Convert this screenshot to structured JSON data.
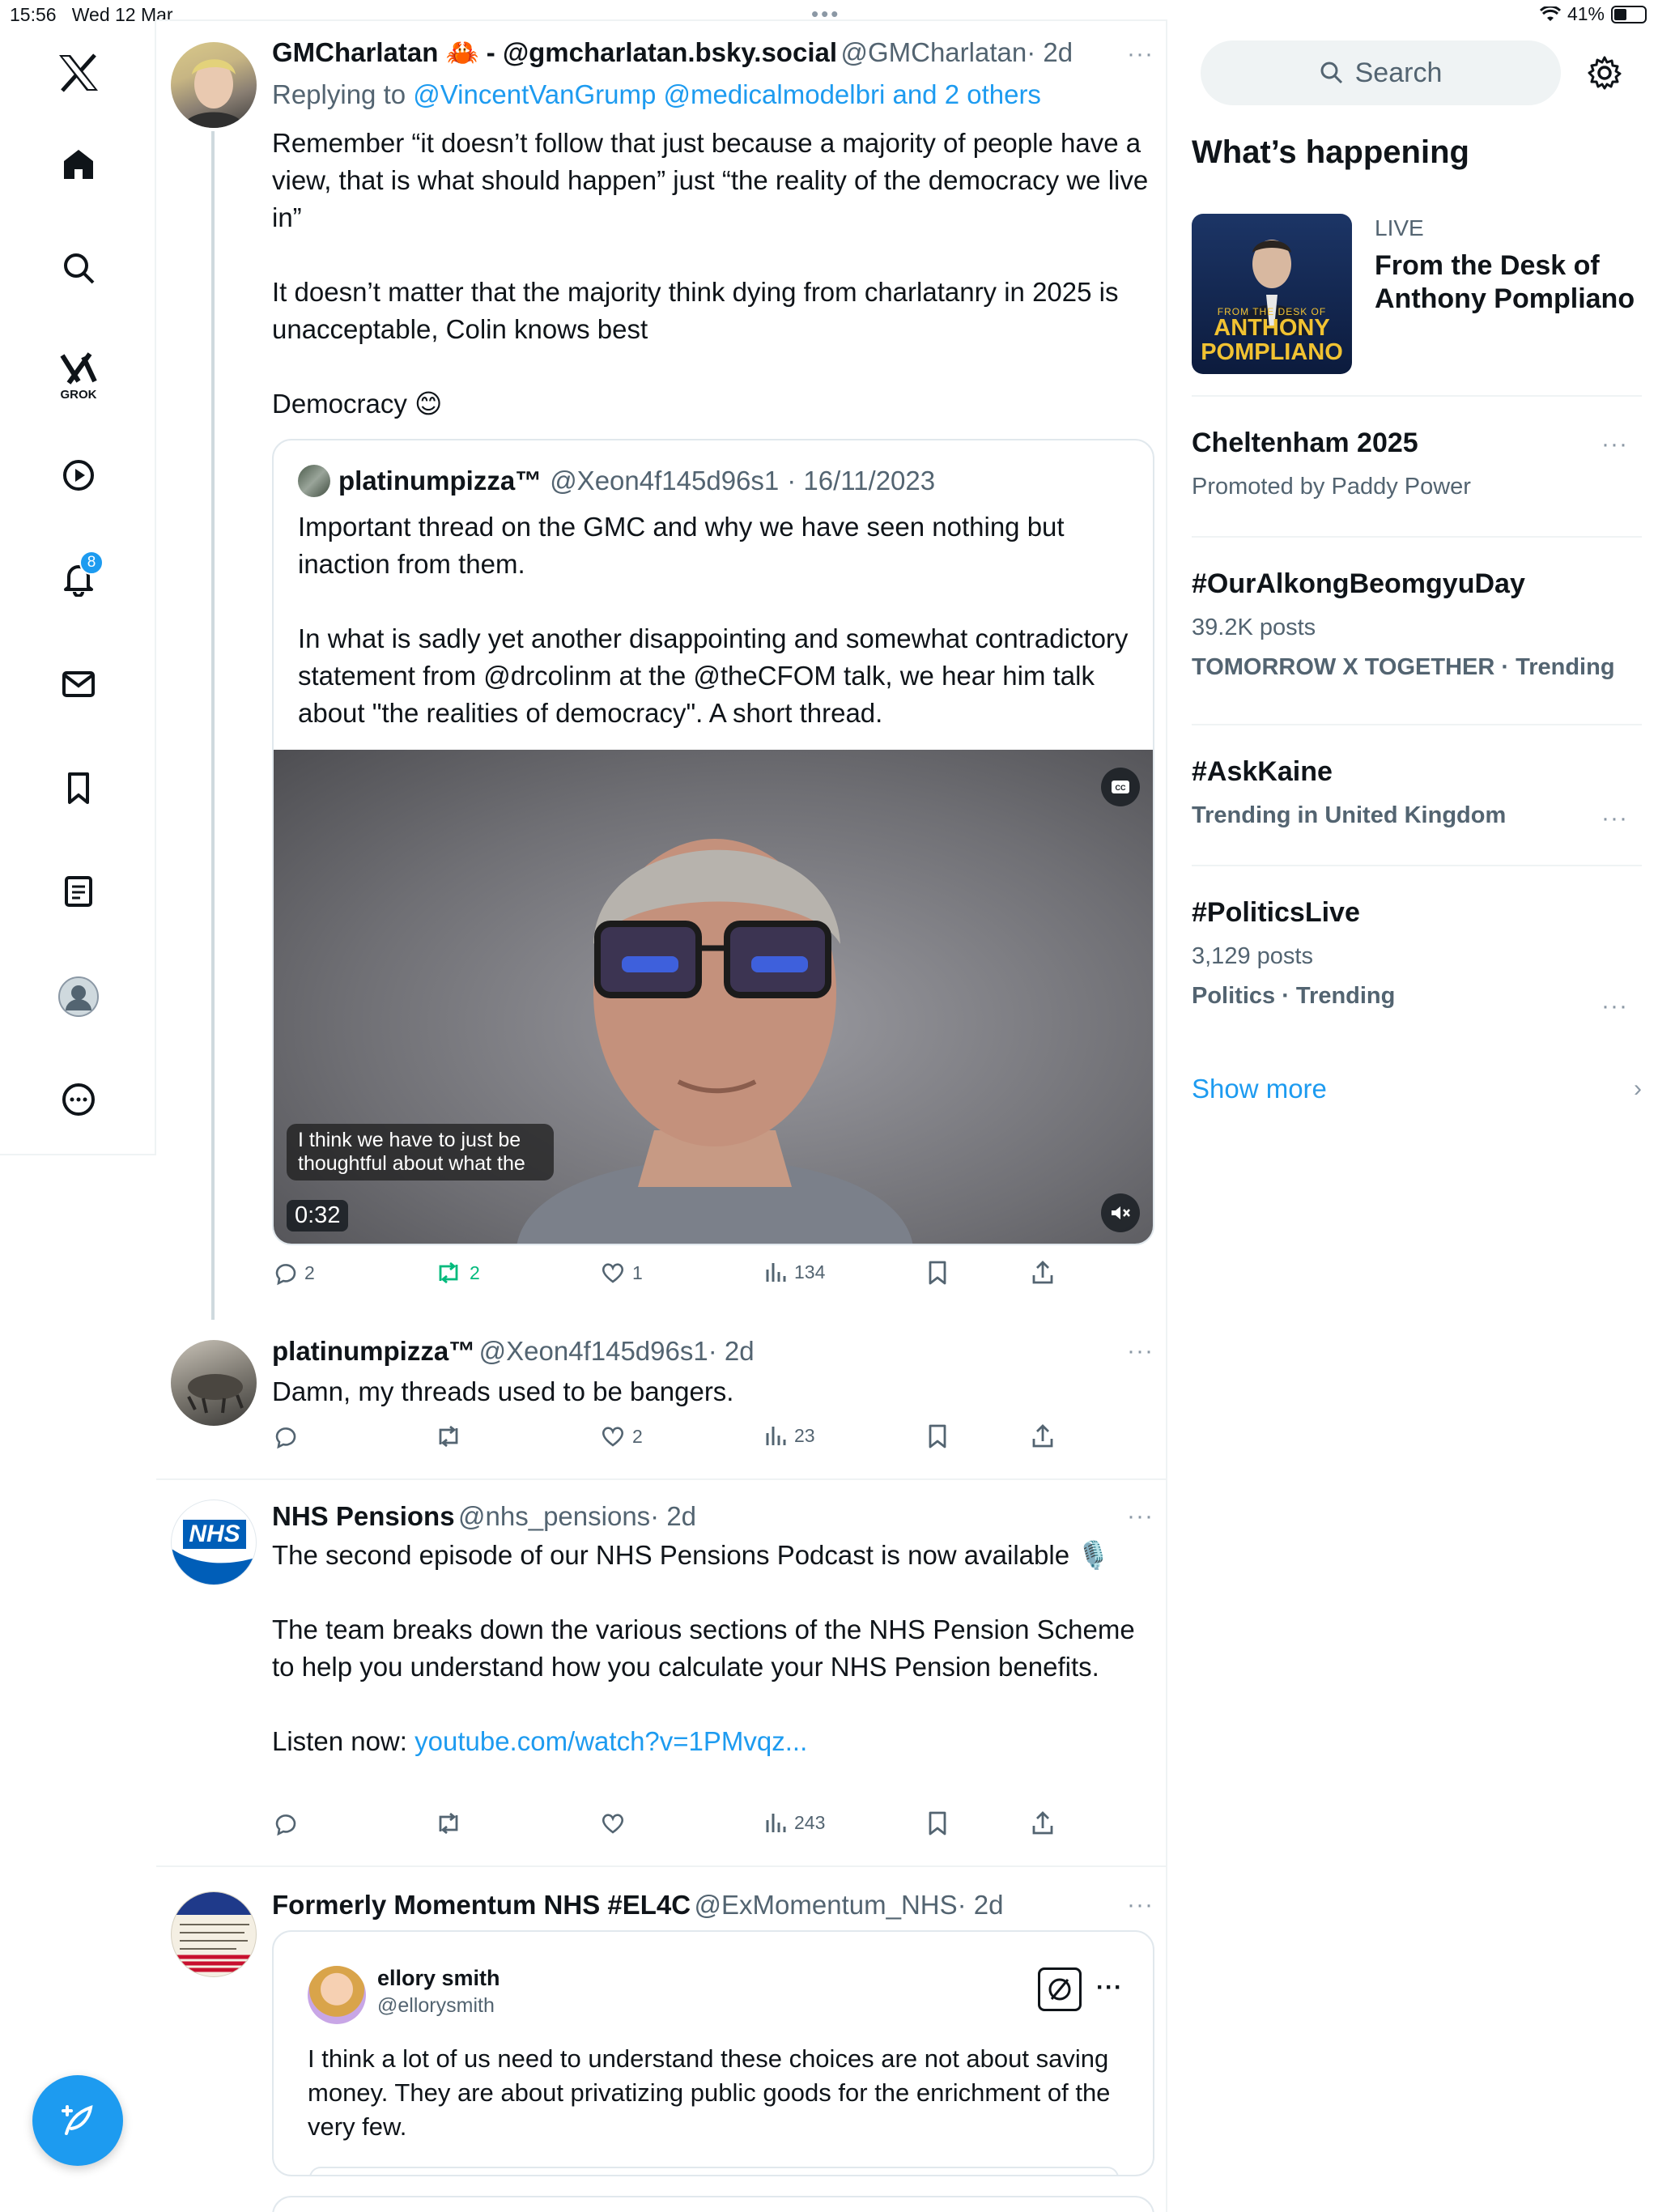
{
  "status": {
    "time": "15:56",
    "date": "Wed 12 Mar",
    "battery": "41%"
  },
  "nav": {
    "notifications_badge": "8",
    "grok_label": "GROK"
  },
  "tweets": [
    {
      "name": "GMCharlatan 🦀 - @gmcharlatan.bsky.social",
      "handle": "@GMCharlatan",
      "time": "· 2d",
      "replying_prefix": "Replying to ",
      "replying_to": "@VincentVanGrump @medicalmodelbri and 2 others",
      "text_p1": "Remember “it doesn’t follow that just because a majority of people have a view, that is what should happen” just “the reality of the democracy we live in”",
      "text_p2": "It doesn’t matter that the majority think dying from charlatanry in 2025 is unacceptable, Colin knows best",
      "text_p3": "Democracy 😊",
      "quote": {
        "name": "platinumpizza™",
        "handle": "@Xeon4f145d96s1",
        "date": "· 16/11/2023",
        "text_p1": "Important thread on the GMC and why we have seen nothing but inaction from them.",
        "text_p2": "In what is sadly yet another disappointing and somewhat contradictory statement from @drcolinm at the @theCFOM talk, we hear him talk about \"the realities of democracy\". A short thread.",
        "video_caption": "I think we have to just be thoughtful about what the",
        "video_duration": "0:32"
      },
      "stats": {
        "replies": "2",
        "retweets": "2",
        "likes": "1",
        "views": "134"
      }
    },
    {
      "name": "platinumpizza™",
      "handle": "@Xeon4f145d96s1",
      "time": "· 2d",
      "text": "Damn, my threads used to be bangers.",
      "stats": {
        "replies": "",
        "retweets": "",
        "likes": "2",
        "views": "23"
      }
    },
    {
      "name": "NHS Pensions",
      "handle": "@nhs_pensions",
      "time": "· 2d",
      "avatar_text": "NHS",
      "text_p1": "The second episode of our NHS Pensions Podcast is now available 🎙️",
      "text_p2": "The team breaks down the various sections of the NHS Pension Scheme to help you understand how you calculate your NHS Pension benefits.",
      "listen_prefix": "Listen now: ",
      "listen_link": "youtube.com/watch?v=1PMvqz...",
      "stats": {
        "replies": "",
        "retweets": "",
        "likes": "",
        "views": "243"
      }
    },
    {
      "name": "Formerly Momentum NHS #EL4C",
      "handle": "@ExMomentum_NHS",
      "time": "· 2d",
      "embed": {
        "name": "ellory smith",
        "handle": "@ellorysmith",
        "text": "I think a lot of us need to understand these choices are not about saving money. They are about privatizing public goods for the enrichment of the very few."
      }
    }
  ],
  "sidebar": {
    "search_placeholder": "Search",
    "whats_happening": "What’s happening",
    "live": {
      "label": "LIVE",
      "title": "From the Desk of Anthony Pompliano",
      "thumb_small": "FROM THE DESK OF",
      "thumb_line1": "ANTHONY",
      "thumb_line2": "POMPLIANO"
    },
    "trends": [
      {
        "name": "Cheltenham 2025",
        "meta": "Promoted by Paddy Power"
      },
      {
        "name": "#OurAlkongBeomgyuDay",
        "count": "39.2K posts",
        "meta": "TOMORROW X TOGETHER · Trending"
      },
      {
        "name": "#AskKaine",
        "meta": "Trending in United Kingdom"
      },
      {
        "name": "#PoliticsLive",
        "count": "3,129 posts",
        "meta": "Politics · Trending"
      }
    ],
    "show_more": "Show more"
  },
  "colors": {
    "accent": "#1d9bf0",
    "retweet": "#00ba7c",
    "nhs_blue": "#005eb8"
  }
}
